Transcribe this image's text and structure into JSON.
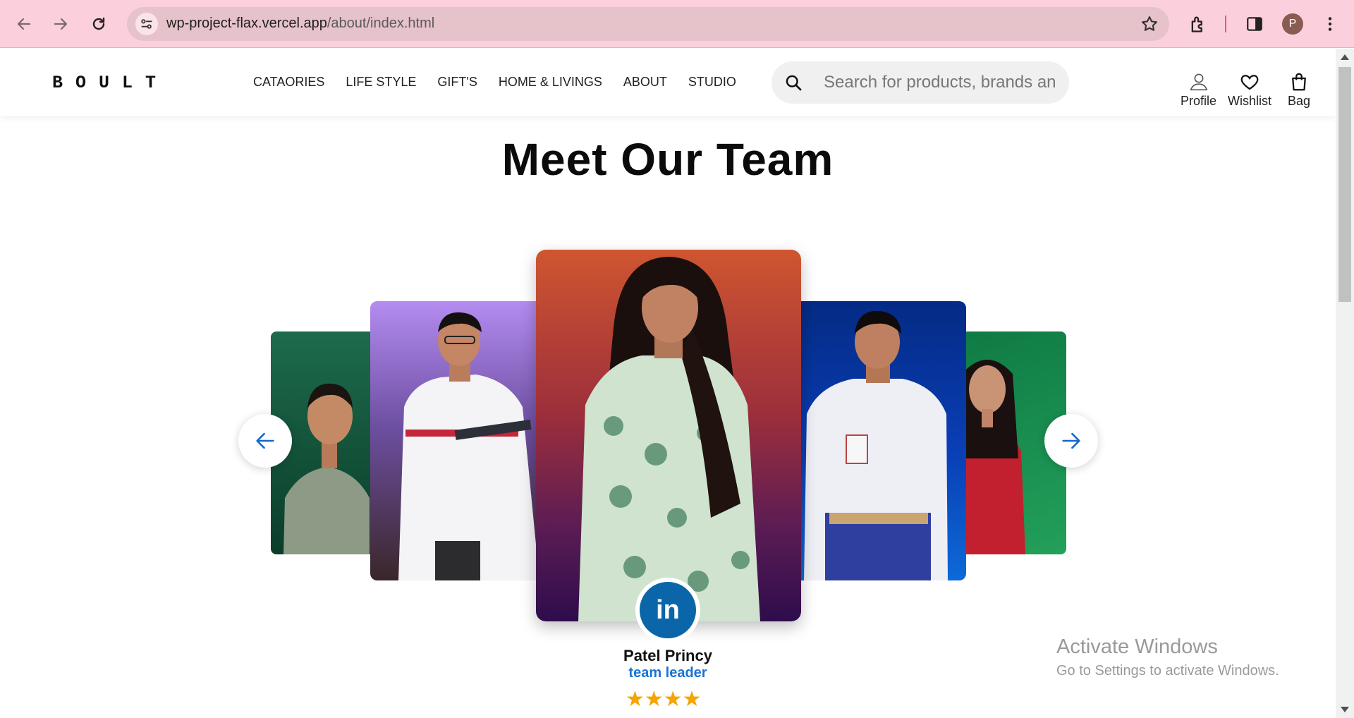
{
  "browser": {
    "url_host": "wp-project-flax.vercel.app",
    "url_path": "/about/index.html",
    "avatar_letter": "P",
    "colors": {
      "frame": "#fbd0dc",
      "omnibox": "#e6c2cb",
      "avatar": "#8a5b53"
    }
  },
  "header": {
    "logo": "BOULT",
    "menu": [
      "CATAORIES",
      "LIFE STYLE",
      "GIFT'S",
      "HOME & LIVINGS",
      "ABOUT",
      "STUDIO"
    ],
    "search": {
      "placeholder": "Search for products, brands and more",
      "value": ""
    },
    "actions": {
      "profile": "Profile",
      "wishlist": "Wishlist",
      "bag": "Bag"
    }
  },
  "team": {
    "title": "Meet Our Team",
    "active_member": {
      "name": "Patel Princy",
      "role": "team leader",
      "stars": "★★★★",
      "social_label": "in"
    },
    "colors": {
      "role": "#1874d6",
      "star": "#f5a400",
      "linkedin": "#0a66a8"
    }
  },
  "watermark": {
    "line1": "Activate Windows",
    "line2": "Go to Settings to activate Windows."
  }
}
